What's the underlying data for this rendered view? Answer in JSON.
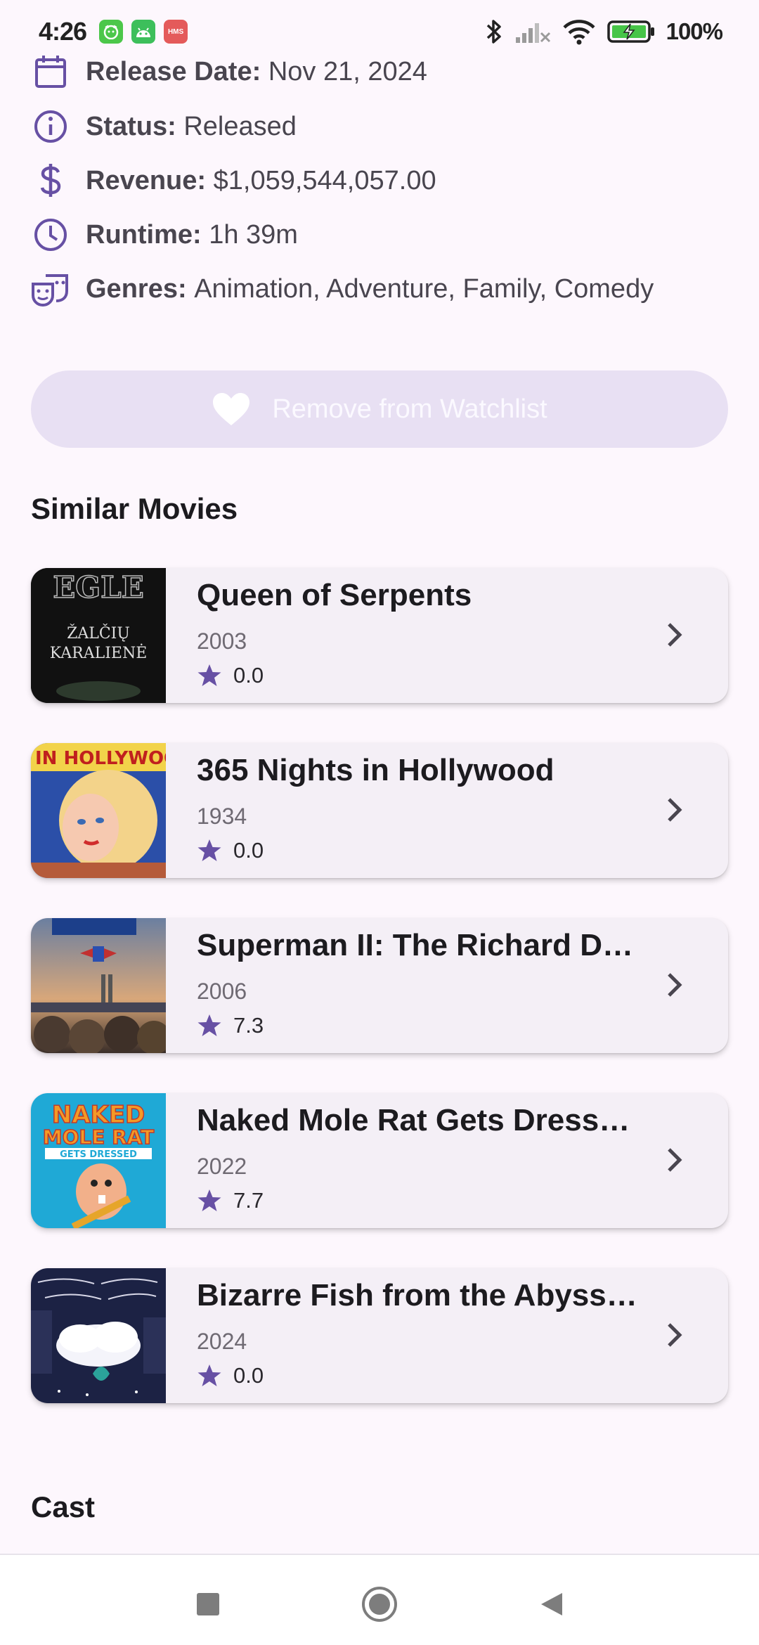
{
  "status_bar": {
    "time": "4:26",
    "battery": "100%",
    "red_badge_label": "HMS"
  },
  "details": [
    {
      "icon": "calendar-icon",
      "label": "Release Date",
      "value": "Nov 21, 2024"
    },
    {
      "icon": "info-icon",
      "label": "Status",
      "value": "Released"
    },
    {
      "icon": "dollar-icon",
      "label": "Revenue",
      "value": "$1,059,544,057.00"
    },
    {
      "icon": "clock-icon",
      "label": "Runtime",
      "value": "1h 39m"
    },
    {
      "icon": "theater-masks-icon",
      "label": "Genres",
      "value": "Animation, Adventure, Family, Comedy"
    }
  ],
  "watchlist_button": {
    "label": "Remove from Watchlist",
    "icon": "heart-icon"
  },
  "similar_movies": {
    "title": "Similar Movies",
    "items": [
      {
        "title": "Queen of Serpents",
        "year": "2003",
        "rating": "0.0",
        "poster_text": "EGLE ŽALČIŲ KARALIENĖ"
      },
      {
        "title": "365 Nights in Hollywood",
        "year": "1934",
        "rating": "0.0",
        "poster_text": "IN HOLLYWOOD"
      },
      {
        "title": "Superman II: The Richard Do…",
        "year": "2006",
        "rating": "7.3",
        "poster_text": ""
      },
      {
        "title": "Naked Mole Rat Gets Dresse…",
        "year": "2022",
        "rating": "7.7",
        "poster_text": "NAKED MOLE RAT GETS DRESSED"
      },
      {
        "title": "Bizarre Fish from the Abyssal…",
        "year": "2024",
        "rating": "0.0",
        "poster_text": ""
      }
    ]
  },
  "cast": {
    "title": "Cast"
  },
  "colors": {
    "accent": "#6750a4",
    "background": "#fdf7fd",
    "card": "#f4eff6",
    "button": "#e8e0f3"
  }
}
